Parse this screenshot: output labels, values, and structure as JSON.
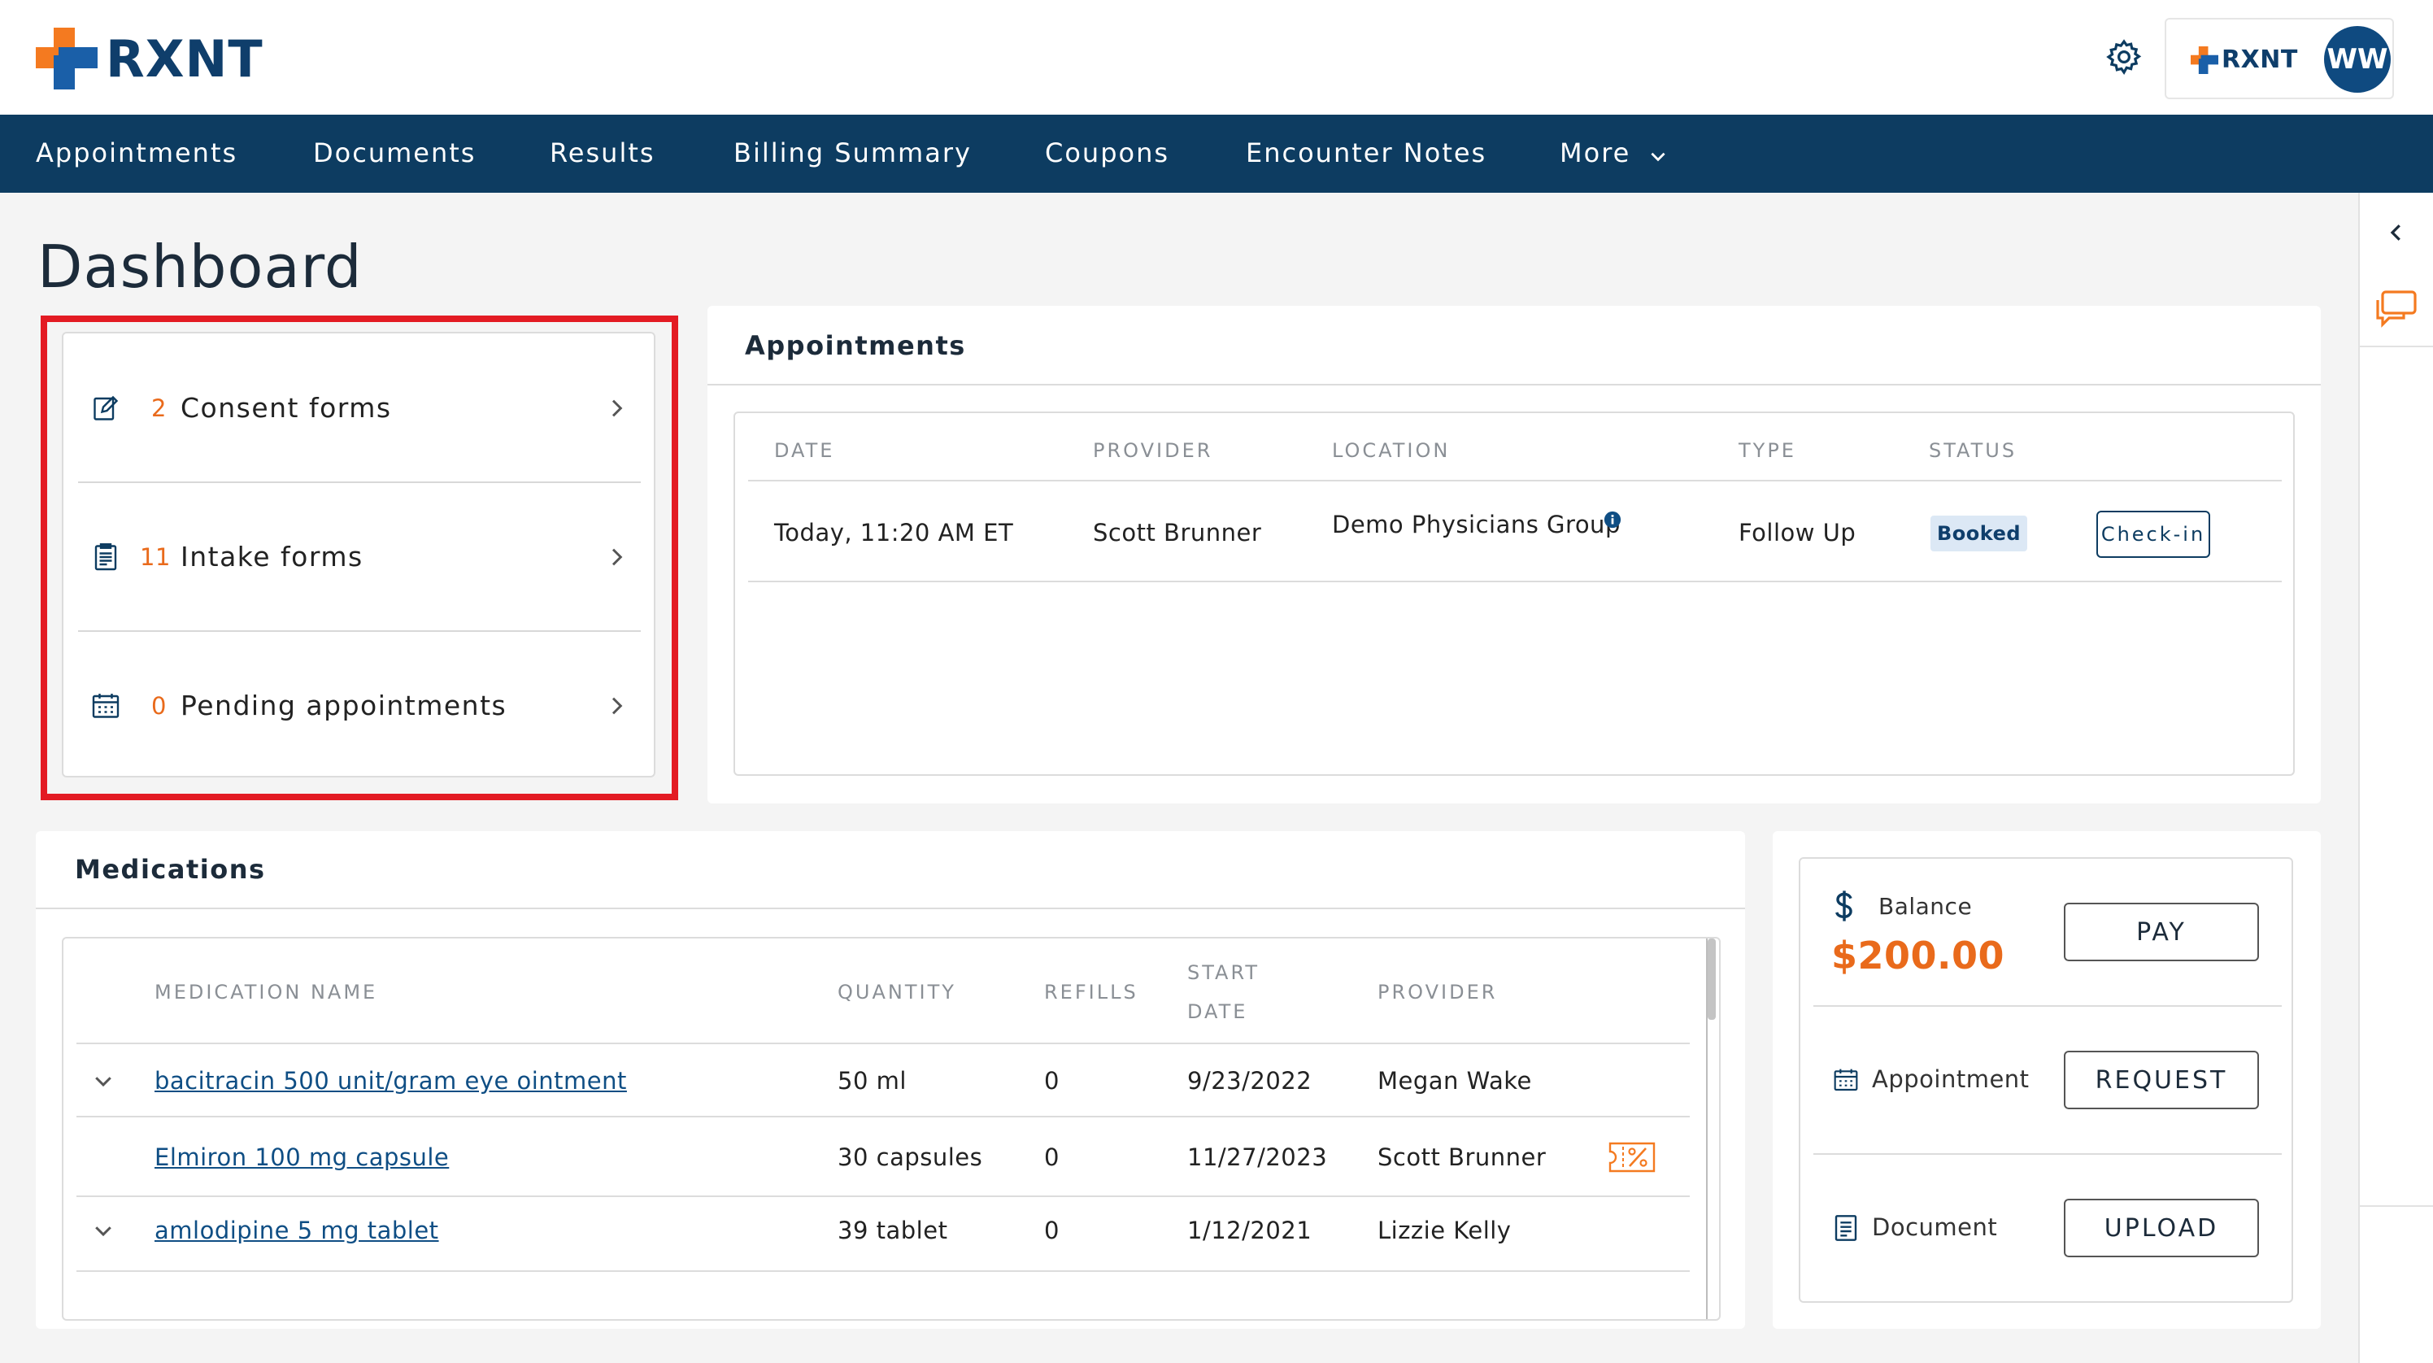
{
  "brand": {
    "name": "RXNT",
    "mini_name": "RXNT",
    "orange": "#f47a20",
    "blue": "#1a5fa8",
    "navy": "#0d3c61"
  },
  "user": {
    "initials": "WW"
  },
  "nav": {
    "items": [
      "Appointments",
      "Documents",
      "Results",
      "Billing Summary",
      "Coupons",
      "Encounter Notes",
      "More"
    ]
  },
  "page": {
    "title": "Dashboard"
  },
  "quick": {
    "items": [
      {
        "count": "2",
        "label": "Consent forms",
        "icon": "edit-form-icon"
      },
      {
        "count": "11",
        "label": "Intake forms",
        "icon": "clipboard-icon"
      },
      {
        "count": "0",
        "label": "Pending appointments",
        "icon": "calendar-icon"
      }
    ]
  },
  "appointments": {
    "title": "Appointments",
    "headers": [
      "DATE",
      "PROVIDER",
      "LOCATION",
      "TYPE",
      "STATUS"
    ],
    "rows": [
      {
        "date": "Today, 11:20 AM ET",
        "provider": "Scott Brunner",
        "location": "Demo Physicians Group",
        "type": "Follow Up",
        "status": "Booked",
        "action": "Check-in"
      }
    ]
  },
  "medications": {
    "title": "Medications",
    "headers": {
      "name": "MEDICATION NAME",
      "quantity": "QUANTITY",
      "refills": "REFILLS",
      "start_1": "START",
      "start_2": "DATE",
      "provider": "PROVIDER"
    },
    "rows": [
      {
        "name": "bacitracin 500 unit/gram eye ointment",
        "quantity": "50 ml",
        "refills": "0",
        "start": "9/23/2022",
        "provider": "Megan Wake"
      },
      {
        "name": "Elmiron 100 mg capsule",
        "quantity": "30 capsules",
        "refills": "0",
        "start": "11/27/2023",
        "provider": "Scott Brunner"
      },
      {
        "name": "amlodipine 5 mg tablet",
        "quantity": "39 tablet",
        "refills": "0",
        "start": "1/12/2021",
        "provider": "Lizzie Kelly"
      }
    ]
  },
  "billing": {
    "balance_label": "Balance",
    "balance_value": "$200.00",
    "pay_label": "PAY",
    "appointment_label": "Appointment",
    "request_label": "REQUEST",
    "document_label": "Document",
    "upload_label": "UPLOAD"
  }
}
